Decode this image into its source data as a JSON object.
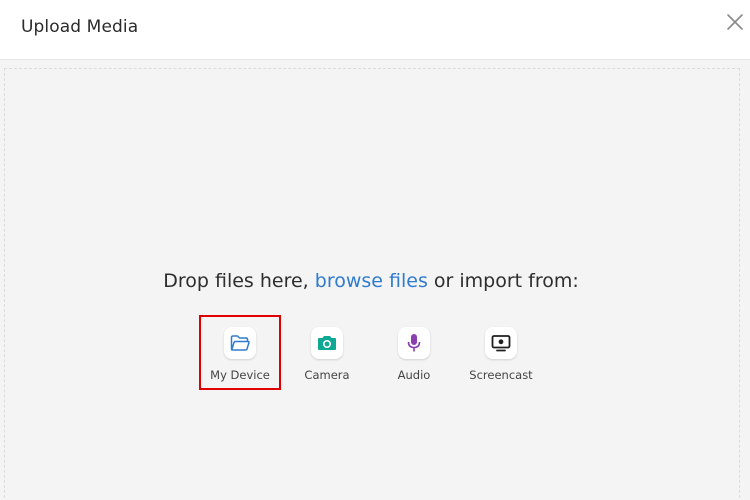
{
  "dialog": {
    "title": "Upload Media",
    "close_icon": "close-icon"
  },
  "dropzone": {
    "prefix": "Drop files here, ",
    "browse_link": "browse files",
    "suffix": " or import from:"
  },
  "sources": [
    {
      "label": "My Device",
      "icon": "folder-icon",
      "color": "#2f7bcf",
      "selected": true
    },
    {
      "label": "Camera",
      "icon": "camera-icon",
      "color": "#0fa896"
    },
    {
      "label": "Audio",
      "icon": "microphone-icon",
      "color": "#8a3fb0"
    },
    {
      "label": "Screencast",
      "icon": "screen-icon",
      "color": "#1f1f1f"
    }
  ],
  "colors": {
    "link": "#2f7bcf",
    "selection_border": "#e00000",
    "dropzone_bg": "#f4f4f4"
  }
}
